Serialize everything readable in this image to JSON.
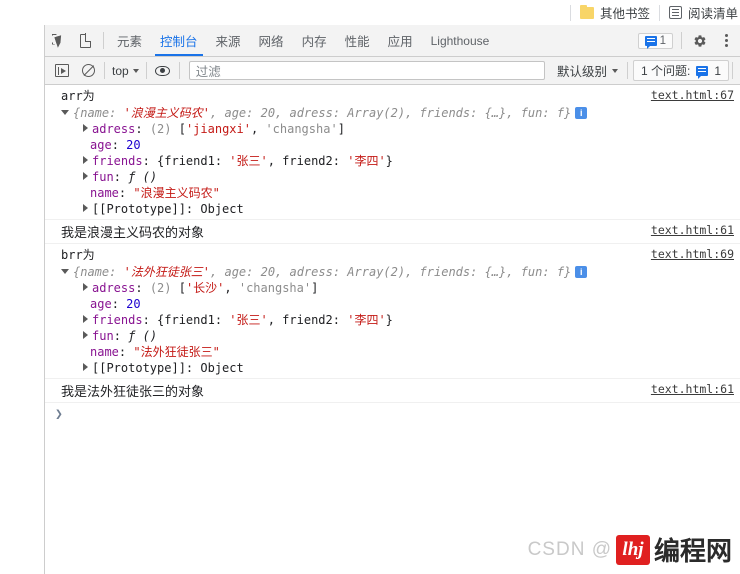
{
  "bookmarks_bar": {
    "items": [
      {
        "icon": "folder-icon",
        "label": "其他书签"
      },
      {
        "icon": "reading-list-icon",
        "label": "阅读清单"
      }
    ]
  },
  "devtools": {
    "tabs": [
      {
        "label": "元素",
        "active": false
      },
      {
        "label": "控制台",
        "active": true
      },
      {
        "label": "来源",
        "active": false
      },
      {
        "label": "网络",
        "active": false
      },
      {
        "label": "内存",
        "active": false
      },
      {
        "label": "性能",
        "active": false
      },
      {
        "label": "应用",
        "active": false
      },
      {
        "label": "Lighthouse",
        "active": false
      }
    ],
    "tabbar_issue_count": "1",
    "toolbar": {
      "context": "top",
      "filter_placeholder": "过滤",
      "filter_value": "",
      "levels_label": "默认级别",
      "issues_label": "1 个问题:",
      "issues_count": "1"
    }
  },
  "console": {
    "entries": [
      {
        "type": "group",
        "label": "arr为",
        "source": "text.html:67",
        "preview": {
          "open": true,
          "prefix": "{name: ",
          "name_value": "'浪漫主义码农'",
          "rest": ", age: 20, adress: Array(2), friends: {…}, fun: f}",
          "info_badge": "i"
        },
        "props": [
          {
            "expandable": true,
            "key": "adress",
            "value_html": "(2) ['jiangxi', 'changsha']"
          },
          {
            "expandable": false,
            "key": "age",
            "value_html": "20"
          },
          {
            "expandable": true,
            "key": "friends",
            "value_html": "{friend1: '张三', friend2: '李四'}"
          },
          {
            "expandable": true,
            "key": "fun",
            "value_html": "f ()"
          },
          {
            "expandable": false,
            "key": "name",
            "value_html": "\"浪漫主义码农\""
          },
          {
            "expandable": true,
            "key": "[[Prototype]]",
            "value_html": "Object"
          }
        ]
      },
      {
        "type": "message",
        "text": "我是浪漫主义码农的对象",
        "source": "text.html:61"
      },
      {
        "type": "group",
        "label": "brr为",
        "source": "text.html:69",
        "preview": {
          "open": true,
          "prefix": "{name: ",
          "name_value": "'法外狂徒张三'",
          "rest": ", age: 20, adress: Array(2), friends: {…}, fun: f}",
          "info_badge": "i"
        },
        "props": [
          {
            "expandable": true,
            "key": "adress",
            "value_html": "(2) ['长沙', 'changsha']"
          },
          {
            "expandable": false,
            "key": "age",
            "value_html": "20"
          },
          {
            "expandable": true,
            "key": "friends",
            "value_html": "{friend1: '张三', friend2: '李四'}"
          },
          {
            "expandable": true,
            "key": "fun",
            "value_html": "f ()"
          },
          {
            "expandable": false,
            "key": "name",
            "value_html": "\"法外狂徒张三\""
          },
          {
            "expandable": true,
            "key": "[[Prototype]]",
            "value_html": "Object"
          }
        ]
      },
      {
        "type": "message",
        "text": "我是法外狂徒张三的对象",
        "source": "text.html:61"
      }
    ],
    "prompt_caret": "❯"
  },
  "watermark": {
    "csdn": "CSDN @",
    "logo_text": "lhj",
    "brand": "编程网"
  },
  "colors": {
    "accent": "#1a73e8",
    "string": "#c41a16",
    "key": "#881391",
    "number": "#1c00cf",
    "preview_gray": "#8c8c8c",
    "panel_bg": "#f3f3f3"
  }
}
